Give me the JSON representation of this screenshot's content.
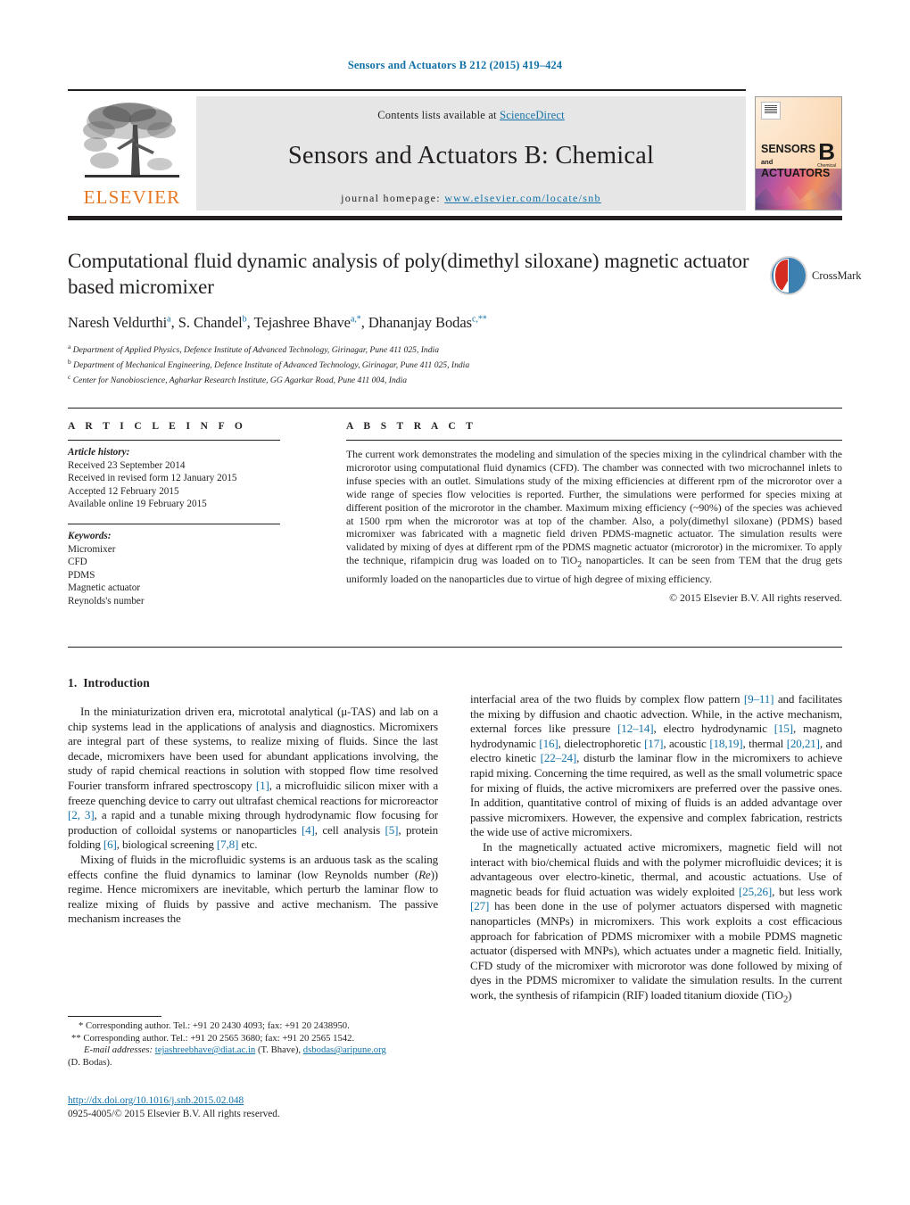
{
  "running_head": "Sensors and Actuators B 212 (2015) 419–424",
  "masthead": {
    "contents_prefix": "Contents lists available at ",
    "sciencedirect": "ScienceDirect",
    "journal_title": "Sensors and Actuators B: Chemical",
    "homepage_prefix": "journal homepage: ",
    "homepage_url": "www.elsevier.com/locate/snb",
    "publisher": "ELSEVIER",
    "cover": {
      "line1": "SENSORS",
      "and": "and",
      "line2": "ACTUATORS",
      "letter": "B",
      "letter_sub": "Chemical"
    }
  },
  "article": {
    "title": "Computational fluid dynamic analysis of poly(dimethyl siloxane) magnetic actuator based micromixer",
    "authors_html": "Naresh Veldurthi<sup>a</sup>, S. Chandel<sup>b</sup>, Tejashree Bhave<sup>a,*</sup>, Dhananjay Bodas<sup>c,**</sup>",
    "affiliations": [
      {
        "marker": "a",
        "text": "Department of Applied Physics, Defence Institute of Advanced Technology, Girinagar, Pune 411 025, India"
      },
      {
        "marker": "b",
        "text": "Department of Mechanical Engineering, Defence Institute of Advanced Technology, Girinagar, Pune 411 025, India"
      },
      {
        "marker": "c",
        "text": "Center for Nanobioscience, Agharkar Research Institute, GG Agarkar Road, Pune 411 004, India"
      }
    ],
    "crossmark_label": "CrossMark"
  },
  "article_info": {
    "heading": "A R T I C L E    I N F O",
    "history_label": "Article history:",
    "history": [
      "Received 23 September 2014",
      "Received in revised form 12 January 2015",
      "Accepted 12 February 2015",
      "Available online 19 February 2015"
    ],
    "keywords_label": "Keywords:",
    "keywords": [
      "Micromixer",
      "CFD",
      "PDMS",
      "Magnetic actuator",
      "Reynolds's number"
    ]
  },
  "abstract": {
    "heading": "A B S T R A C T",
    "text_html": "The current work demonstrates the modeling and simulation of the species mixing in the cylindrical chamber with the microrotor using computational fluid dynamics (CFD). The chamber was connected with two microchannel inlets to infuse species with an outlet. Simulations study of the mixing efficiencies at different rpm of the microrotor over a wide range of species flow velocities is reported. Further, the simulations were performed for species mixing at different position of the microrotor in the chamber. Maximum mixing efficiency (~90%) of the species was achieved at 1500 rpm when the microrotor was at top of the chamber. Also, a poly(dimethyl siloxane) (PDMS) based micromixer was fabricated with a magnetic field driven PDMS-magnetic actuator. The simulation results were validated by mixing of dyes at different rpm of the PDMS magnetic actuator (microrotor) in the micromixer. To apply the technique, rifampicin drug was loaded on to TiO<sub>2</sub> nanoparticles. It can be seen from TEM that the drug gets uniformly loaded on the nanoparticles due to virtue of high degree of mixing efficiency.",
    "copyright": "© 2015 Elsevier B.V. All rights reserved."
  },
  "body": {
    "section_number": "1.",
    "section_title": "Introduction",
    "left_paragraphs_html": [
      "In the miniaturization driven era, micrototal analytical (μ-TAS) and lab on a chip systems lead in the applications of analysis and diagnostics. Micromixers are integral part of these systems, to realize mixing of fluids. Since the last decade, micromixers have been used for abundant applications involving, the study of rapid chemical reactions in solution with stopped flow time resolved Fourier transform infrared spectroscopy <span class=\"ref\">[1]</span>, a microfluidic silicon mixer with a freeze quenching device to carry out ultrafast chemical reactions for microreactor <span class=\"ref\">[2, 3]</span>, a rapid and a tunable mixing through hydrodynamic flow focusing for production of colloidal systems or nanoparticles <span class=\"ref\">[4]</span>, cell analysis <span class=\"ref\">[5]</span>, protein folding <span class=\"ref\">[6]</span>, biological screening <span class=\"ref\">[7,8]</span> etc.",
      "Mixing of fluids in the microfluidic systems is an arduous task as the scaling effects confine the fluid dynamics to laminar (low Reynolds number (<i>Re</i>)) regime. Hence micromixers are inevitable, which perturb the laminar flow to realize mixing of fluids by passive and active mechanism. The passive mechanism increases the"
    ],
    "right_paragraphs_html": [
      "interfacial area of the two fluids by complex flow pattern <span class=\"ref\">[9–11]</span> and facilitates the mixing by diffusion and chaotic advection. While, in the active mechanism, external forces like pressure <span class=\"ref\">[12–14]</span>, electro hydrodynamic <span class=\"ref\">[15]</span>, magneto hydrodynamic <span class=\"ref\">[16]</span>, dielectrophoretic <span class=\"ref\">[17]</span>, acoustic <span class=\"ref\">[18,19]</span>, thermal <span class=\"ref\">[20,21]</span>, and electro kinetic <span class=\"ref\">[22–24]</span>, disturb the laminar flow in the micromixers to achieve rapid mixing. Concerning the time required, as well as the small volumetric space for mixing of fluids, the active micromixers are preferred over the passive ones. In addition, quantitative control of mixing of fluids is an added advantage over passive micromixers. However, the expensive and complex fabrication, restricts the wide use of active micromixers.",
      "In the magnetically actuated active micromixers, magnetic field will not interact with bio/chemical fluids and with the polymer microfluidic devices; it is advantageous over electro-kinetic, thermal, and acoustic actuations. Use of magnetic beads for fluid actuation was widely exploited <span class=\"ref\">[25,26]</span>, but less work <span class=\"ref\">[27]</span> has been done in the use of polymer actuators dispersed with magnetic nanoparticles (MNPs) in micromixers. This work exploits a cost efficacious approach for fabrication of PDMS micromixer with a mobile PDMS magnetic actuator (dispersed with MNPs), which actuates under a magnetic field. Initially, CFD study of the micromixer with microrotor was done followed by mixing of dyes in the PDMS micromixer to validate the simulation results. In the current work, the synthesis of rifampicin (RIF) loaded titanium dioxide (TiO<sub>2</sub>)"
    ]
  },
  "footnotes": {
    "line1": "*  Corresponding author. Tel.: +91 20 2430 4093; fax: +91 20 2438950.",
    "line2": "**  Corresponding author. Tel.: +91 20 2565 3680; fax: +91 20 2565 1542.",
    "email_label": "E-mail addresses:",
    "email1": "tejashreebhave@diat.ac.in",
    "email1_person": " (T. Bhave), ",
    "email2": "dsbodas@aripune.org",
    "email2_person": "(D. Bodas)."
  },
  "footer": {
    "doi": "http://dx.doi.org/10.1016/j.snb.2015.02.048",
    "issn_line": "0925-4005/© 2015 Elsevier B.V. All rights reserved."
  },
  "colors": {
    "link": "#1272a8",
    "elsevier_orange": "#e87722",
    "text": "#231f20",
    "masthead_gray": "#e6e6e6"
  }
}
